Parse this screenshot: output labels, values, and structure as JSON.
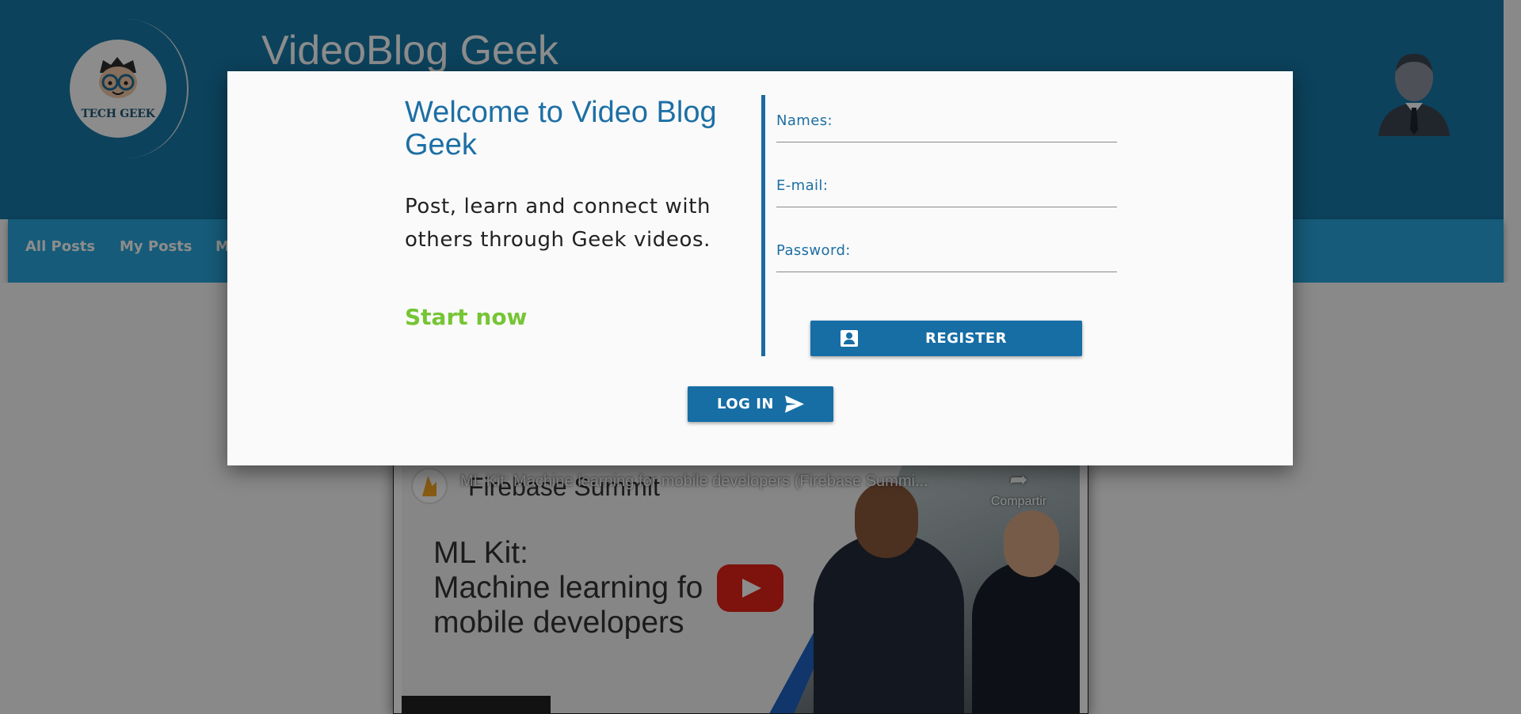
{
  "header": {
    "site_title": "VideoBlog Geek",
    "logo_text": "TECH GEEK"
  },
  "nav": {
    "items": [
      {
        "label": "All Posts"
      },
      {
        "label": "My Posts"
      },
      {
        "label": "M"
      }
    ]
  },
  "video": {
    "channel_label": "Firebase Summit",
    "title": "ML Kit: Machine learning for mobile developers (Firebase Summi...",
    "share_label": "Compartir",
    "slide_line1": "ML Kit:",
    "slide_line2": "Machine learning fo",
    "slide_line3": "mobile developers"
  },
  "modal": {
    "welcome_title": "Welcome to Video Blog Geek",
    "welcome_sub": "Post, learn and connect with others through Geek videos.",
    "start_now": "Start now",
    "fields": {
      "names_label": "Names:",
      "email_label": "E-mail:",
      "password_label": "Password:"
    },
    "register_label": "REGISTER",
    "login_label": "LOG IN"
  },
  "colors": {
    "header": "#1778a8",
    "navbar": "#29a7dd",
    "primary": "#176ea5",
    "accent_green": "#75c535"
  }
}
